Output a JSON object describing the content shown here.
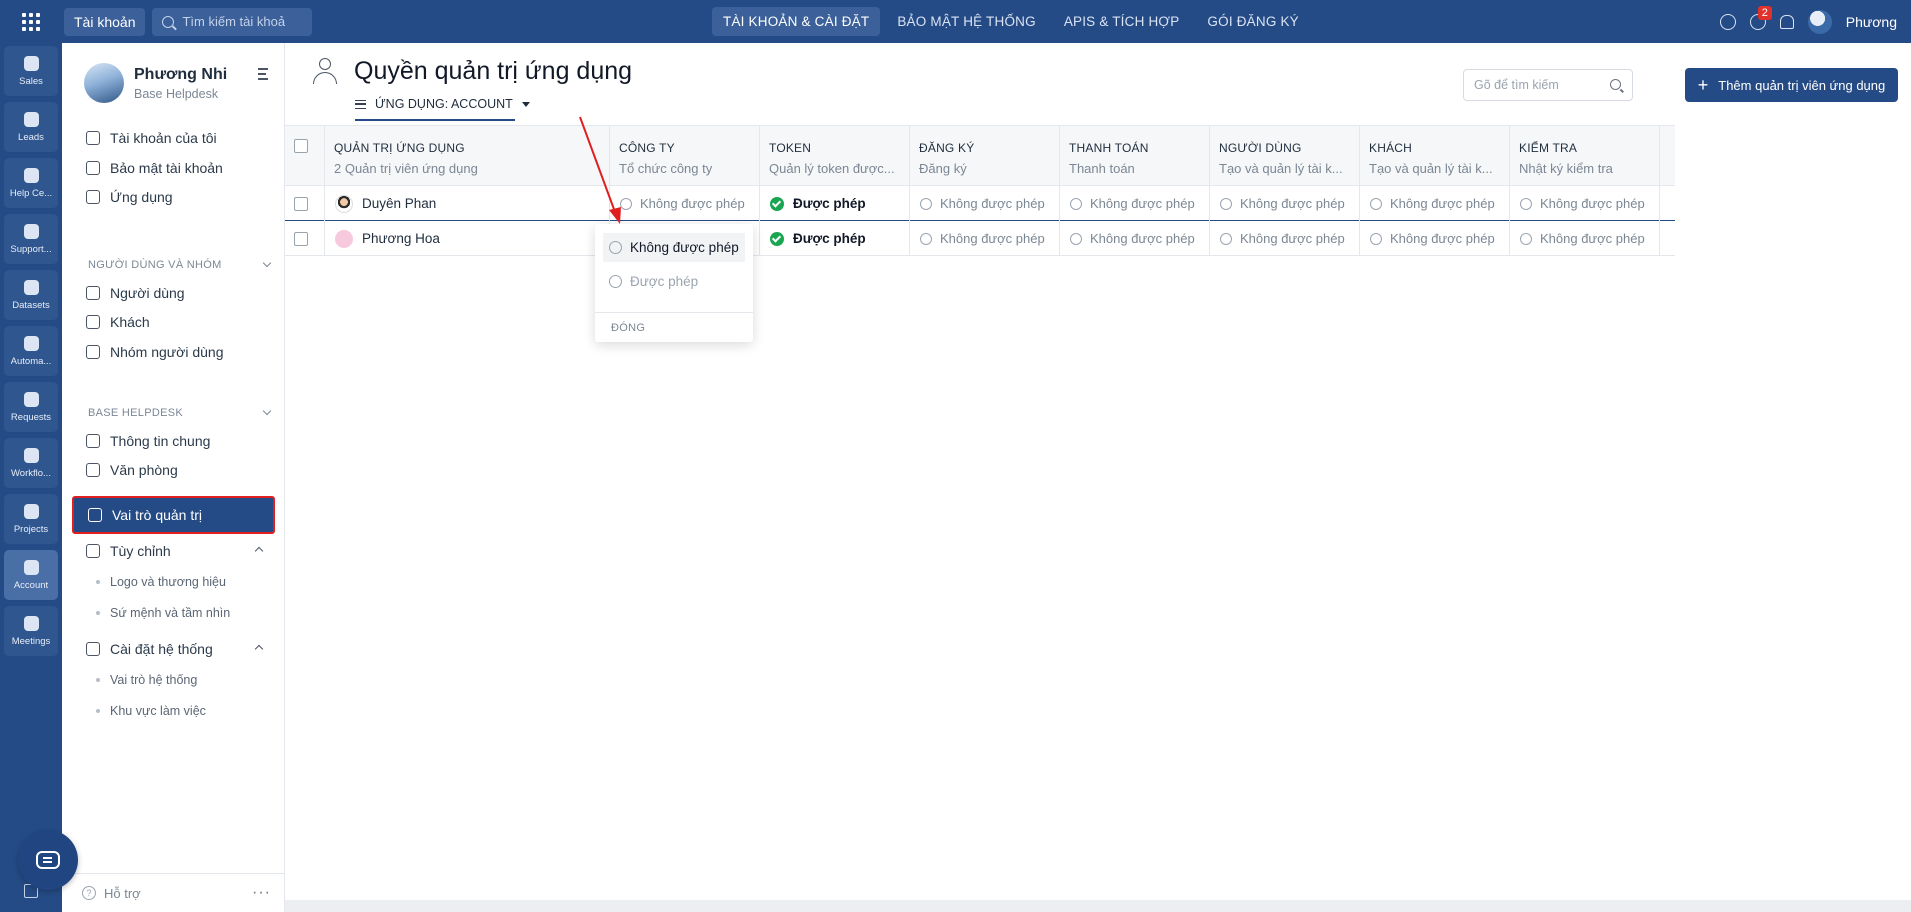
{
  "topbar": {
    "account_chip": "Tài khoản",
    "search_placeholder": "Tìm kiếm tài khoả",
    "nav": [
      "TÀI KHOẢN & CÀI ĐẶT",
      "BẢO MẬT HỆ THỐNG",
      "APIS & TÍCH HỢP",
      "GÓI ĐĂNG KÝ"
    ],
    "notification_count": "2",
    "user_name": "Phương"
  },
  "rail": {
    "items": [
      "Sales",
      "Leads",
      "Help Ce...",
      "Support...",
      "Datasets",
      "Automa...",
      "Requests",
      "Workflo...",
      "Projects",
      "Account",
      "Meetings"
    ],
    "active": "Account"
  },
  "sidebar": {
    "profile_name": "Phương Nhi",
    "profile_sub": "Base Helpdesk",
    "items_top": [
      "Tài khoản của tôi",
      "Bảo mật tài khoản",
      "Ứng dụng"
    ],
    "section_users": "NGƯỜI DÙNG VÀ NHÓM",
    "items_users": [
      "Người dùng",
      "Khách",
      "Nhóm người dùng"
    ],
    "section_base": "BASE HELPDESK",
    "items_base": [
      "Thông tin chung",
      "Văn phòng",
      "Vai trò quản trị",
      "Tùy chỉnh"
    ],
    "sub_custom": [
      "Logo và thương hiệu",
      "Sứ mệnh và tầm nhìn"
    ],
    "system_settings": "Cài đặt hệ thống",
    "sub_system": [
      "Vai trò hệ thống",
      "Khu vực làm việc"
    ],
    "footer_help": "Hỗ trợ",
    "footer_more": "···"
  },
  "main": {
    "title": "Quyền quản trị ứng dụng",
    "app_filter": "ỨNG DỤNG: ACCOUNT",
    "search_placeholder": "Gõ để tìm kiếm",
    "add_button": "Thêm quản trị viên ứng dụng"
  },
  "table": {
    "columns": [
      {
        "title": "QUẢN TRỊ ỨNG DỤNG",
        "sub": "2 Quản trị viên ứng dụng"
      },
      {
        "title": "CÔNG TY",
        "sub": "Tổ chức công ty"
      },
      {
        "title": "TOKEN",
        "sub": "Quản lý token được..."
      },
      {
        "title": "ĐĂNG KÝ",
        "sub": "Đăng ký"
      },
      {
        "title": "THANH TOÁN",
        "sub": "Thanh toán"
      },
      {
        "title": "NGƯỜI DÙNG",
        "sub": "Tạo và quản lý tài k..."
      },
      {
        "title": "KHÁCH",
        "sub": "Tạo và quản lý tài k..."
      },
      {
        "title": "KIỂM TRA",
        "sub": "Nhật ký kiểm tra"
      }
    ],
    "rows": [
      {
        "name": "Duyên Phan",
        "cells": [
          "Không được phép",
          "Được phép",
          "Không được phép",
          "Không được phép",
          "Không được phép",
          "Không được phép",
          "Không được phép"
        ]
      },
      {
        "name": "Phương Hoa",
        "cells": [
          "",
          "Được phép",
          "Không được phép",
          "Không được phép",
          "Không được phép",
          "Không được phép",
          "Không được phép"
        ]
      }
    ]
  },
  "dropdown": {
    "options": [
      "Không được phép",
      "Được phép"
    ],
    "close": "ĐÓNG"
  },
  "colors": {
    "brand": "#254b86",
    "success": "#1aa651",
    "highlight": "#e02020"
  }
}
